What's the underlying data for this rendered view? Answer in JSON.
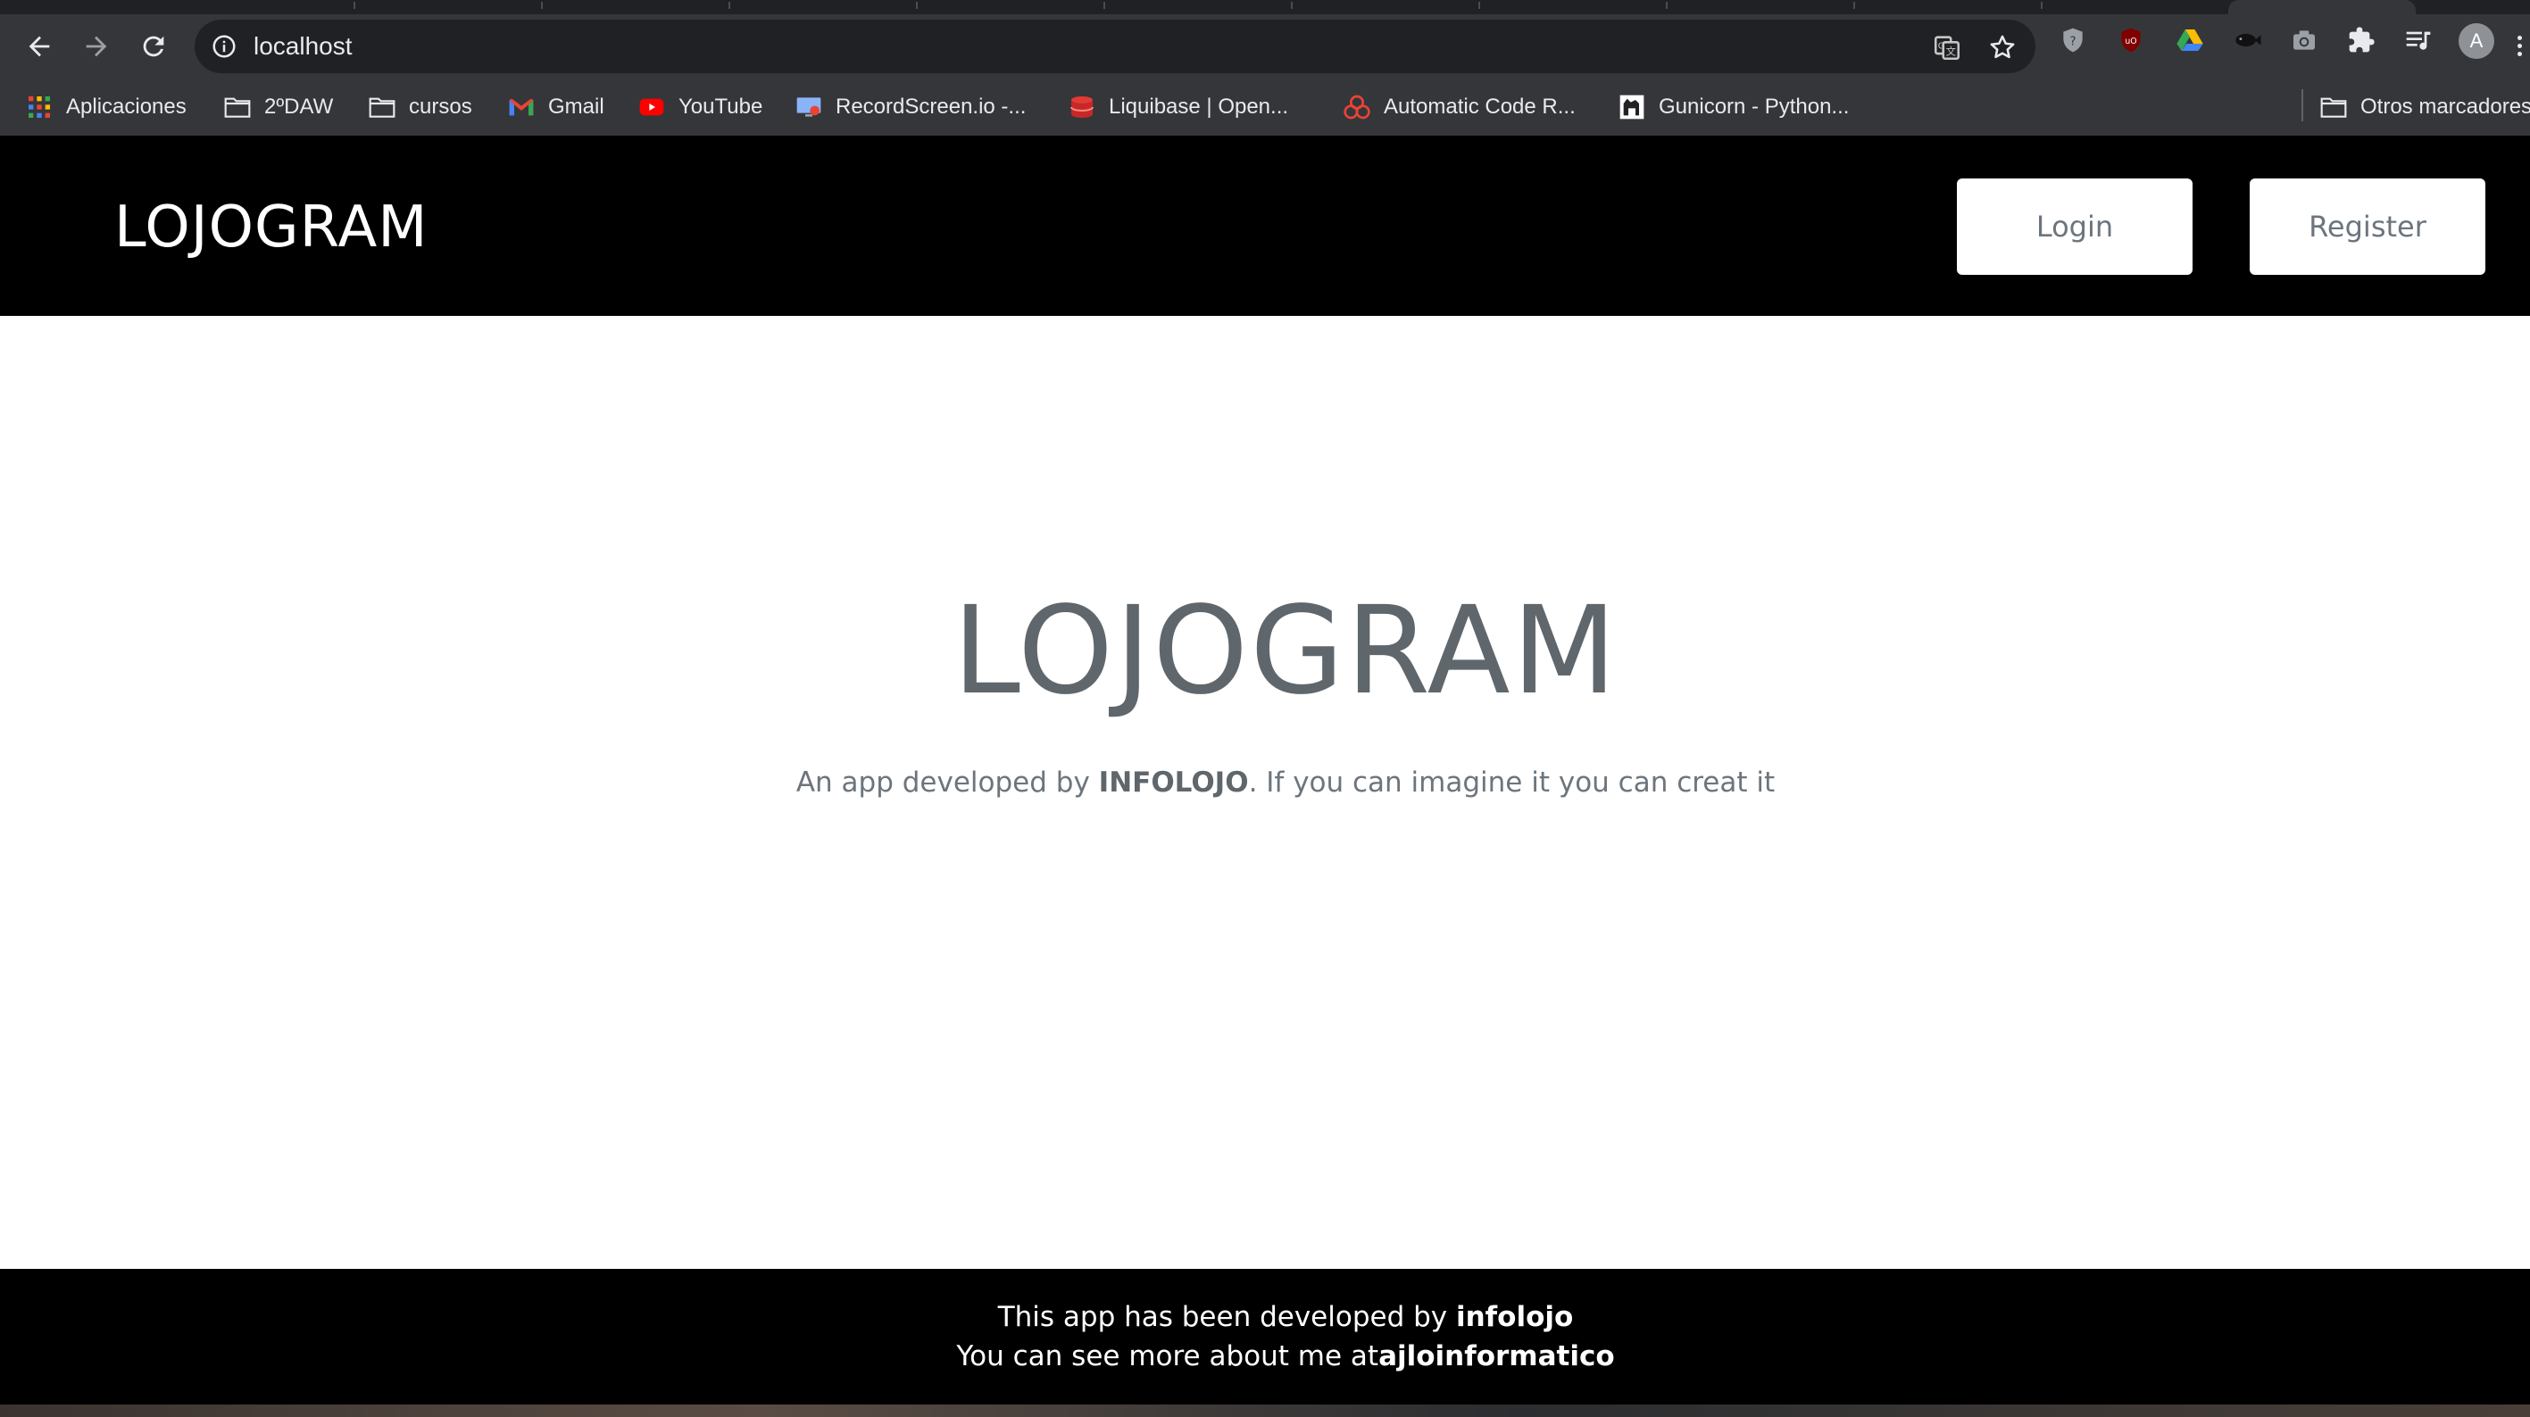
{
  "browser": {
    "url": "localhost",
    "bookmarks": [
      {
        "label": "Aplicaciones",
        "icon": "apps-grid-icon"
      },
      {
        "label": "2ºDAW",
        "icon": "folder-icon"
      },
      {
        "label": "cursos",
        "icon": "folder-icon"
      },
      {
        "label": "Gmail",
        "icon": "gmail-icon"
      },
      {
        "label": "YouTube",
        "icon": "youtube-icon"
      },
      {
        "label": "RecordScreen.io -...",
        "icon": "recordscreen-icon"
      },
      {
        "label": "Liquibase | Open...",
        "icon": "liquibase-icon"
      },
      {
        "label": "Automatic Code R...",
        "icon": "codacy-icon"
      },
      {
        "label": "Gunicorn - Python...",
        "icon": "gunicorn-icon"
      },
      {
        "label": "Otros marcadores",
        "icon": "folder-icon"
      }
    ],
    "profile_initial": "A"
  },
  "header": {
    "brand": "LOJOGRAM",
    "login_label": "Login",
    "register_label": "Register"
  },
  "hero": {
    "title": "LOJOGRAM",
    "subtitle_prefix": "An app developed by ",
    "subtitle_brand": "INFOLOJO",
    "subtitle_suffix": ". If you can imagine it you can creat it"
  },
  "footer": {
    "line1_prefix": "This app has been developed by ",
    "line1_name": "infolojo",
    "line2_prefix": "You can see more about me at",
    "line2_link": "ajloinformatico"
  },
  "colors": {
    "header_bg": "#000000",
    "hero_title": "#5f676c",
    "text_muted": "#6c757d",
    "chrome_bg": "#35363a"
  }
}
